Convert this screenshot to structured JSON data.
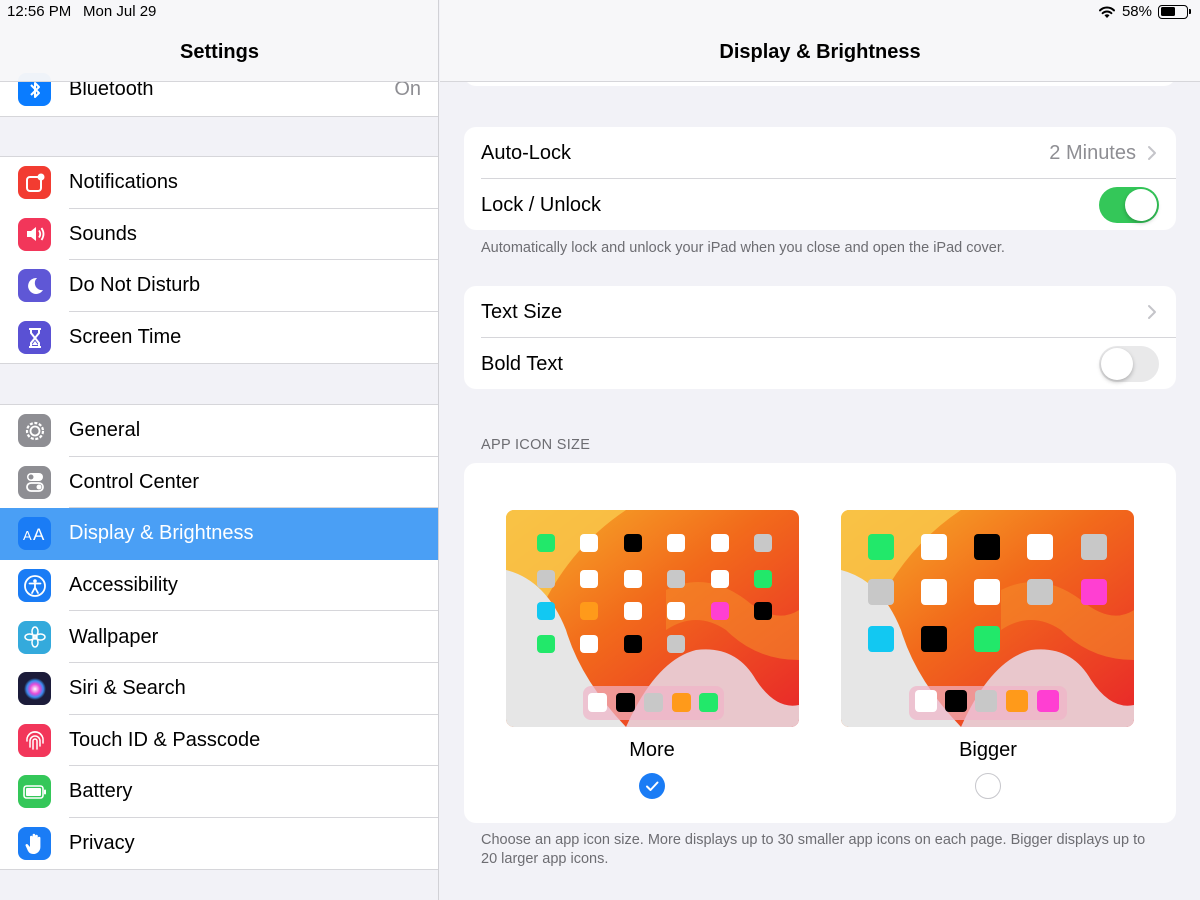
{
  "status_bar": {
    "time": "12:56 PM",
    "date": "Mon Jul 29",
    "battery": "58%",
    "battery_level": 0.58
  },
  "sidebar": {
    "title": "Settings",
    "group0": [
      {
        "label": "Bluetooth",
        "value": "On",
        "icon": "bluetooth-icon",
        "color": "#0a7cff"
      }
    ],
    "group1": [
      {
        "label": "Notifications",
        "icon": "notifications-icon",
        "color": "#f23c31"
      },
      {
        "label": "Sounds",
        "icon": "sounds-icon",
        "color": "#f2365a"
      },
      {
        "label": "Do Not Disturb",
        "icon": "moon-icon",
        "color": "#5f57d6"
      },
      {
        "label": "Screen Time",
        "icon": "hourglass-icon",
        "color": "#5a51d4"
      }
    ],
    "group2": [
      {
        "label": "General",
        "icon": "gear-icon",
        "color": "#8e8e93"
      },
      {
        "label": "Control Center",
        "icon": "switches-icon",
        "color": "#8e8e93"
      },
      {
        "label": "Display & Brightness",
        "icon": "text-size-icon",
        "color": "#1a7cf5",
        "selected": true
      },
      {
        "label": "Accessibility",
        "icon": "accessibility-icon",
        "color": "#1a7cf5"
      },
      {
        "label": "Wallpaper",
        "icon": "flower-icon",
        "color": "#34aadc"
      },
      {
        "label": "Siri & Search",
        "icon": "siri-icon",
        "color": "#1c1c3a"
      },
      {
        "label": "Touch ID & Passcode",
        "icon": "fingerprint-icon",
        "color": "#f2365a"
      },
      {
        "label": "Battery",
        "icon": "battery-icon",
        "color": "#34c759"
      },
      {
        "label": "Privacy",
        "icon": "hand-icon",
        "color": "#1a7cf5"
      }
    ]
  },
  "main": {
    "title": "Display & Brightness",
    "lock_card": {
      "auto_lock_label": "Auto-Lock",
      "auto_lock_value": "2 Minutes",
      "lock_unlock_label": "Lock / Unlock",
      "lock_unlock_on": true
    },
    "lock_footnote": "Automatically lock and unlock your iPad when you close and open the iPad cover.",
    "text_card": {
      "text_size_label": "Text Size",
      "bold_text_label": "Bold Text",
      "bold_text_on": false
    },
    "icon_size_header": "APP ICON SIZE",
    "icon_options": [
      {
        "label": "More",
        "selected": true
      },
      {
        "label": "Bigger",
        "selected": false
      }
    ],
    "icon_footnote": "Choose an app icon size. More displays up to 30 smaller app icons on each page. Bigger displays up to 20 larger app icons."
  },
  "colors": {
    "accent": "#1a7cf5",
    "selected_row": "#4a9ff5",
    "toggle_on": "#34c759",
    "secondary_text": "#8e8e93"
  }
}
